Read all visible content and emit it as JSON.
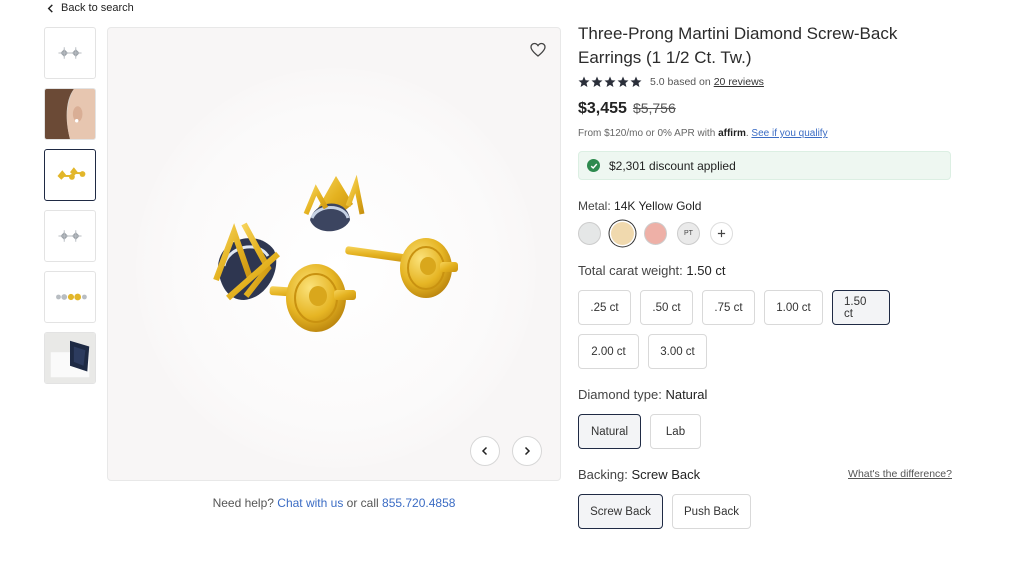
{
  "back": {
    "label": "Back to search"
  },
  "thumbnails": [
    {
      "icon": "earrings-pair-silver-thumbnail"
    },
    {
      "icon": "model-wearing-earring-thumbnail"
    },
    {
      "icon": "earrings-gold-side-thumbnail"
    },
    {
      "icon": "earrings-pair-silver-alt-thumbnail"
    },
    {
      "icon": "earrings-size-compare-thumbnail"
    },
    {
      "icon": "gift-box-thumbnail"
    }
  ],
  "help": {
    "prefix": "Need help?",
    "chat": "Chat with us",
    "middle": "or call",
    "phone": "855.720.4858"
  },
  "product": {
    "title": "Three-Prong Martini Diamond Screw-Back Earrings (1 1/2 Ct. Tw.)",
    "rating_text": "5.0 based on",
    "reviews": "20 reviews",
    "price": "$3,455",
    "old_price": "$5,756",
    "finance_prefix": "From $120/mo or 0% APR with",
    "affirm": "affirm",
    "qualify": "See if you qualify",
    "discount": "$2,301 discount applied"
  },
  "metal": {
    "label": "Metal:",
    "value": "14K Yellow Gold",
    "swatches": [
      {
        "name": "white-gold",
        "color": "#e5e7e7"
      },
      {
        "name": "yellow-gold",
        "color": "#f0d9ae",
        "active": true
      },
      {
        "name": "rose-gold",
        "color": "#eeb0a7"
      },
      {
        "name": "platinum",
        "text": "PT"
      }
    ]
  },
  "carat": {
    "label": "Total carat weight:",
    "value": "1.50 ct",
    "options": [
      ".25 ct",
      ".50 ct",
      ".75 ct",
      "1.00 ct",
      "1.50 ct",
      "2.00 ct",
      "3.00 ct"
    ],
    "selected": "1.50 ct"
  },
  "diamond": {
    "label": "Diamond type:",
    "value": "Natural",
    "options": [
      "Natural",
      "Lab"
    ],
    "selected": "Natural"
  },
  "backing": {
    "label": "Backing:",
    "value": "Screw Back",
    "difference": "What's the difference?",
    "options": [
      "Screw Back",
      "Push Back"
    ],
    "selected": "Screw Back"
  },
  "colors": {
    "accent": "#1f2a44",
    "link": "#3b6cc4",
    "success": "#2d8a4e",
    "gold": "#e8b820"
  }
}
